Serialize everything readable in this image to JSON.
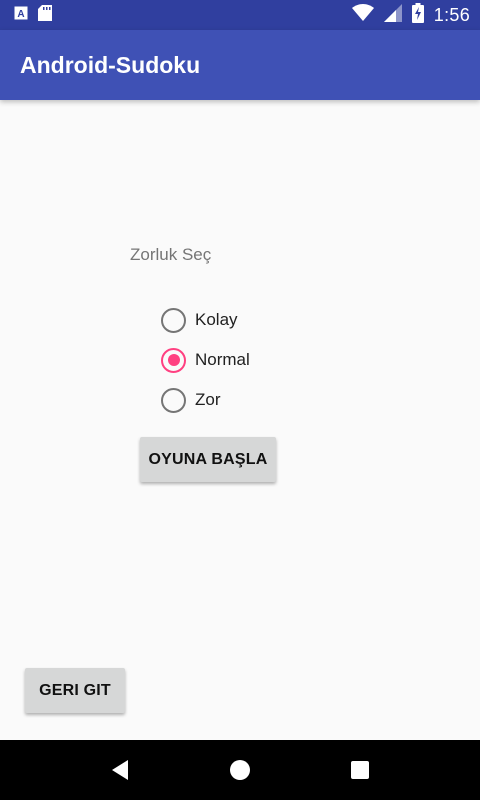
{
  "status_bar": {
    "time": "1:56",
    "icons": [
      "font-icon",
      "sd-card-icon",
      "wifi-icon",
      "signal-icon",
      "battery-charging-icon"
    ]
  },
  "app_bar": {
    "title": "Android-Sudoku"
  },
  "difficulty": {
    "label": "Zorluk Seç",
    "options": [
      {
        "label": "Kolay",
        "checked": false
      },
      {
        "label": "Normal",
        "checked": true
      },
      {
        "label": "Zor",
        "checked": false
      }
    ]
  },
  "buttons": {
    "start": "OYUNA BAŞLA",
    "back": "GERI GIT"
  },
  "nav_bar": {
    "icons": [
      "back-icon",
      "home-icon",
      "recents-icon"
    ]
  },
  "colors": {
    "primary": "#3f51b5",
    "primary_dark": "#303f9f",
    "accent": "#ff4081"
  }
}
